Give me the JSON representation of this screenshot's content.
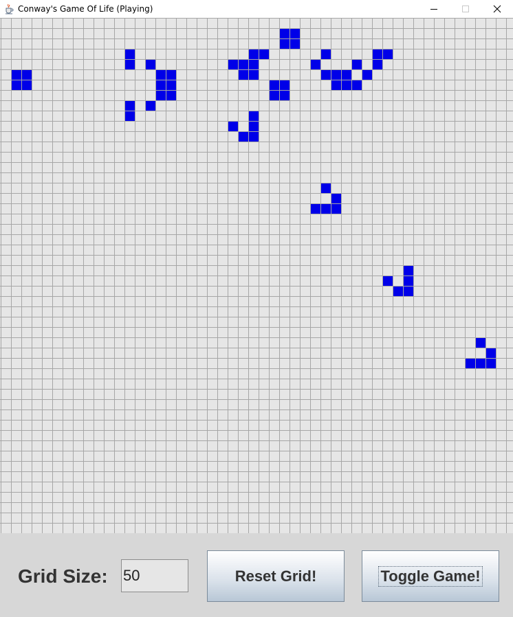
{
  "window": {
    "title": "Conway's Game Of Life (Playing)"
  },
  "grid": {
    "columns": 50,
    "visible_rows": 50,
    "cell_color": "#0000e8",
    "background_color": "#e6e6e6",
    "line_color": "#a6a6a6",
    "live_cells": [
      [
        27,
        1
      ],
      [
        28,
        1
      ],
      [
        27,
        2
      ],
      [
        28,
        2
      ],
      [
        12,
        3
      ],
      [
        24,
        3
      ],
      [
        25,
        3
      ],
      [
        31,
        3
      ],
      [
        36,
        3
      ],
      [
        37,
        3
      ],
      [
        12,
        4
      ],
      [
        14,
        4
      ],
      [
        22,
        4
      ],
      [
        23,
        4
      ],
      [
        24,
        4
      ],
      [
        30,
        4
      ],
      [
        34,
        4
      ],
      [
        36,
        4
      ],
      [
        1,
        5
      ],
      [
        2,
        5
      ],
      [
        15,
        5
      ],
      [
        16,
        5
      ],
      [
        23,
        5
      ],
      [
        24,
        5
      ],
      [
        31,
        5
      ],
      [
        32,
        5
      ],
      [
        33,
        5
      ],
      [
        35,
        5
      ],
      [
        1,
        6
      ],
      [
        2,
        6
      ],
      [
        15,
        6
      ],
      [
        16,
        6
      ],
      [
        27,
        6
      ],
      [
        32,
        6
      ],
      [
        33,
        6
      ],
      [
        34,
        6
      ],
      [
        26,
        6
      ],
      [
        15,
        7
      ],
      [
        16,
        7
      ],
      [
        26,
        7
      ],
      [
        27,
        7
      ],
      [
        12,
        8
      ],
      [
        14,
        8
      ],
      [
        12,
        9
      ],
      [
        24,
        9
      ],
      [
        22,
        10
      ],
      [
        24,
        10
      ],
      [
        23,
        11
      ],
      [
        24,
        11
      ],
      [
        31,
        16
      ],
      [
        32,
        17
      ],
      [
        30,
        18
      ],
      [
        31,
        18
      ],
      [
        32,
        18
      ],
      [
        39,
        24
      ],
      [
        37,
        25
      ],
      [
        39,
        25
      ],
      [
        38,
        26
      ],
      [
        39,
        26
      ],
      [
        46,
        31
      ],
      [
        47,
        32
      ],
      [
        45,
        33
      ],
      [
        46,
        33
      ],
      [
        47,
        33
      ]
    ]
  },
  "controls": {
    "grid_size_label": "Grid Size:",
    "grid_size_value": "50",
    "reset_label": "Reset Grid!",
    "toggle_label": "Toggle Game!"
  },
  "icons": {
    "app": "java-coffee-cup-icon",
    "minimize": "minimize-icon",
    "maximize": "maximize-icon",
    "close": "close-icon"
  }
}
